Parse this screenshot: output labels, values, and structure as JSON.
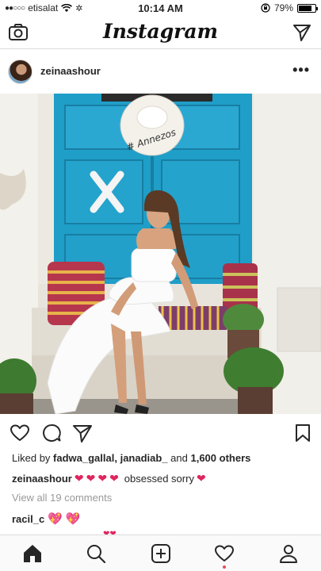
{
  "status_bar": {
    "carrier": "etisalat",
    "time": "10:14 AM",
    "battery_level": "79%",
    "battery_fraction": 0.79
  },
  "top_nav": {
    "logo_text": "Instagram"
  },
  "post": {
    "username": "zeinaashour",
    "hat_text": "# Annezos",
    "likes_prefix": "Liked by ",
    "liker_1": "fadwa_gallal",
    "liker_sep": ", ",
    "liker_2": "janadiab_",
    "likes_middle": " and ",
    "likes_count": "1,600 others",
    "caption_user": "zeinaashour",
    "caption_text": "obsessed sorry",
    "view_comments": "View all 19 comments",
    "comment_user": "racil_c"
  },
  "icons": {
    "camera": "camera-icon",
    "direct": "paper-plane-icon",
    "more": "more-icon",
    "like": "heart-outline-icon",
    "comment": "speech-bubble-icon",
    "share": "paper-plane-icon",
    "save": "bookmark-icon",
    "home": "home-icon",
    "search": "search-icon",
    "add": "plus-square-icon",
    "activity": "heart-outline-icon",
    "profile": "person-icon"
  },
  "colors": {
    "door_blue": "#1f9ec8",
    "emoji_red": "#e0245e",
    "emoji_pink": "#e85aa0",
    "notif_dot": "#ed4956"
  }
}
